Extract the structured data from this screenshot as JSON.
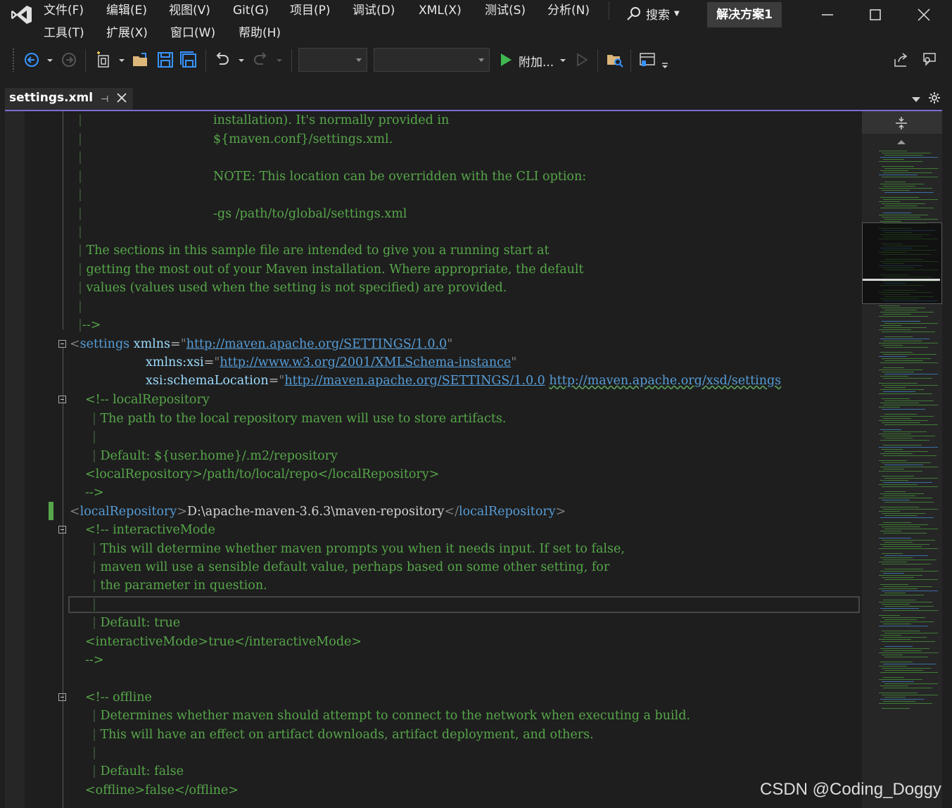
{
  "menu": {
    "row1": [
      "文件(F)",
      "编辑(E)",
      "视图(V)",
      "Git(G)",
      "项目(P)",
      "调试(D)",
      "XML(X)",
      "测试(S)",
      "分析(N)"
    ],
    "row2": [
      "工具(T)",
      "扩展(X)",
      "窗口(W)",
      "帮助(H)"
    ],
    "search_label": "搜索",
    "solution_label": "解决方案1"
  },
  "toolbar": {
    "run_label": "附加..."
  },
  "tab": {
    "title": "settings.xml",
    "pin": "⊣"
  },
  "editor": {
    "l1": "installation). It's normally provided in",
    "l2": "${maven.conf}/settings.xml.",
    "l4": "NOTE: This location can be overridden with the CLI option:",
    "l6": "-gs /path/to/global/settings.xml",
    "l8": "The sections in this sample file are intended to give you a running start at",
    "l9": "getting the most out of your Maven installation. Where appropriate, the default",
    "l10": "values (values used when the setting is not specified) are provided.",
    "l12": "-->",
    "settings_tag": "settings",
    "xmlns_attr": "xmlns",
    "xmlns_val": "http://maven.apache.org/SETTINGS/1.0.0",
    "xsi_attr": "xmlns:xsi",
    "xsi_val": "http://www.w3.org/2001/XMLSchema-instance",
    "schema_attr": "xsi:schemaLocation",
    "schema_val1": "http://maven.apache.org/SETTINGS/1.0.0",
    "schema_val2": "http://maven.apache.org/xsd/settings",
    "lr_comment": "<!-- localRepository",
    "lr_desc": "The path to the local repository maven will use to store artifacts.",
    "lr_default": "Default: ${user.home}/.m2/repository",
    "lr_example": "<localRepository>/path/to/local/repo</localRepository>",
    "comment_end": "-->",
    "lr_tag": "localRepository",
    "lr_value": "D:\\apache-maven-3.6.3\\maven-repository",
    "im_comment": "<!-- interactiveMode",
    "im_d1": "This will determine whether maven prompts you when it needs input. If set to false,",
    "im_d2": "maven will use a sensible default value, perhaps based on some other setting, for",
    "im_d3": "the parameter in question.",
    "im_default": "Default: true",
    "im_example": "<interactiveMode>true</interactiveMode>",
    "off_comment": "<!-- offline",
    "off_d1": "Determines whether maven should attempt to connect to the network when executing a build.",
    "off_d2": "This will have an effect on artifact downloads, artifact deployment, and others.",
    "off_default": "Default: false",
    "off_example": "<offline>false</offline>"
  },
  "watermark": "CSDN @Coding_Doggy",
  "colors": {
    "comment": "#57a64a",
    "tag": "#569cd6",
    "attribute": "#9cdcfe",
    "text": "#d4d4d4",
    "tab_accent": "#7e6bd6",
    "run_green": "#3fb950"
  }
}
